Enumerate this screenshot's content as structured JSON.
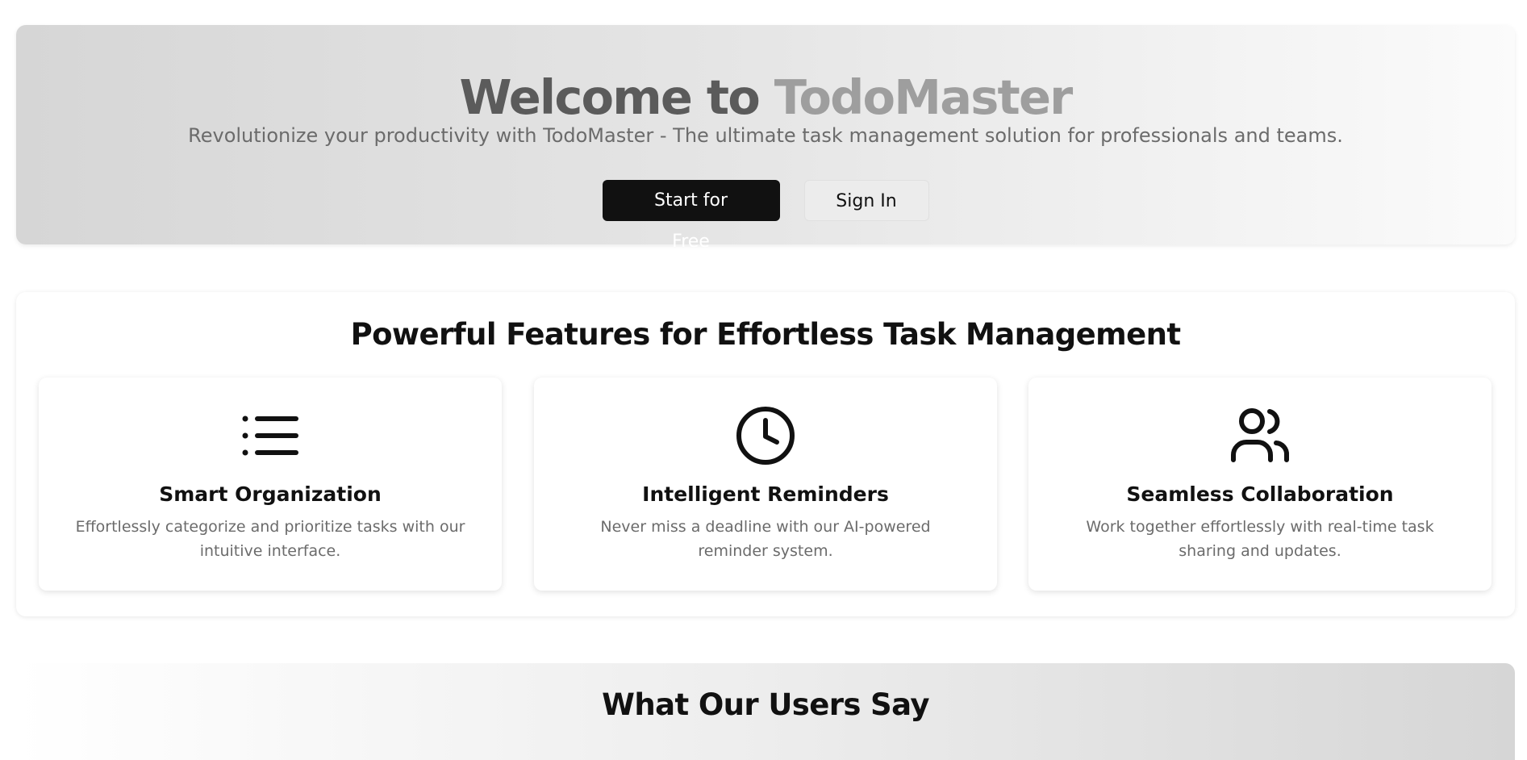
{
  "hero": {
    "title_part1": "Welcome to",
    "title_part2": "TodoMaster",
    "subtitle": "Revolutionize your productivity with TodoMaster - The ultimate task management solution for professionals and teams.",
    "primary_button": "Start for Free",
    "secondary_button": "Sign In"
  },
  "features": {
    "title": "Powerful Features for Effortless Task Management",
    "cards": [
      {
        "icon": "list-icon",
        "title": "Smart Organization",
        "description": "Effortlessly categorize and prioritize tasks with our intuitive interface."
      },
      {
        "icon": "clock-icon",
        "title": "Intelligent Reminders",
        "description": "Never miss a deadline with our AI-powered reminder system."
      },
      {
        "icon": "users-icon",
        "title": "Seamless Collaboration",
        "description": "Work together effortlessly with real-time task sharing and updates."
      }
    ]
  },
  "testimonials": {
    "title": "What Our Users Say"
  },
  "colors": {
    "primary_button_bg": "#111111",
    "title_dark_gray": "#5b5b5b",
    "title_light_gray": "#9e9e9e",
    "body_text_gray": "#6b6b6b"
  }
}
